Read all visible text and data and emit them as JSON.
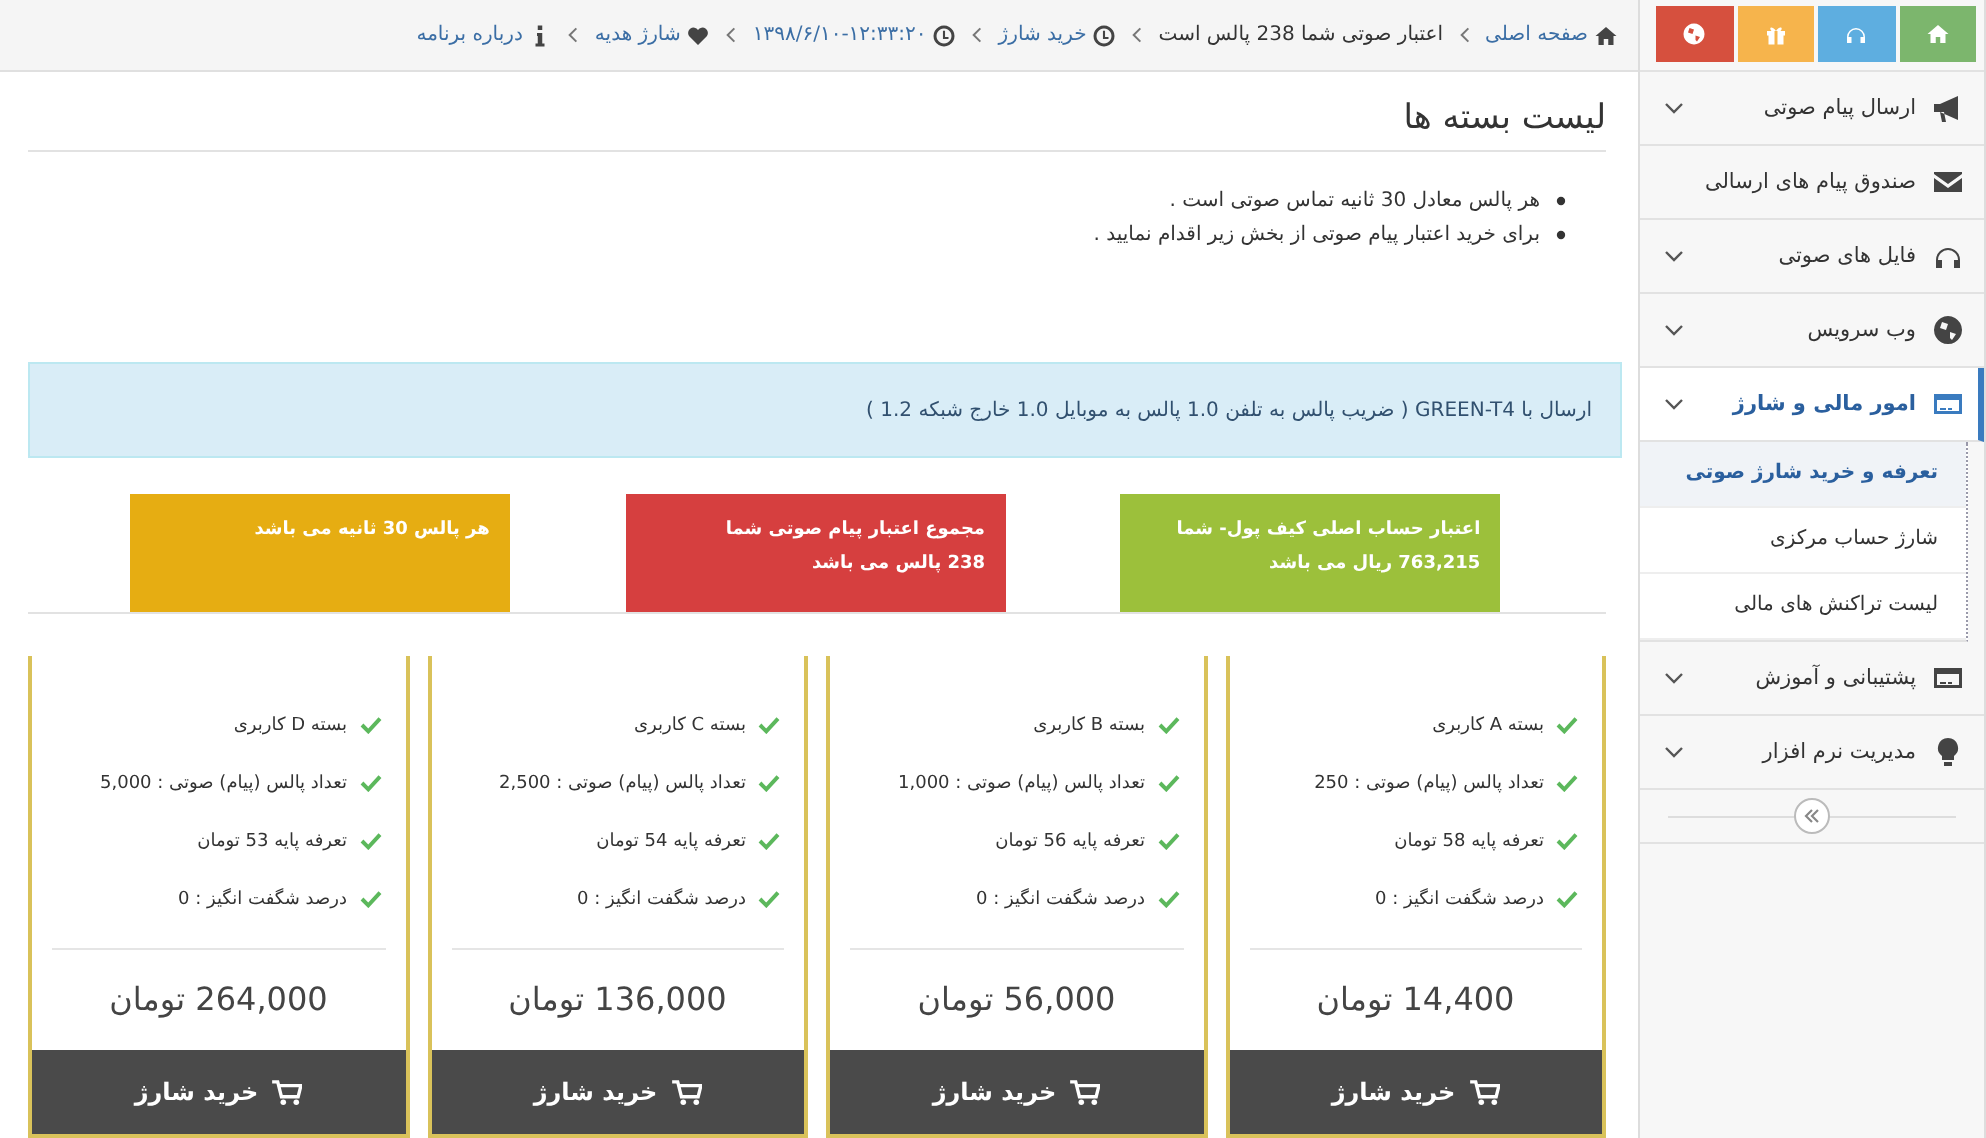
{
  "breadcrumb": [
    {
      "kind": "home",
      "text": "صفحه اصلی",
      "link": true
    },
    {
      "kind": "plain",
      "text": "اعتبار صوتی شما 238 پالس است",
      "link": false
    },
    {
      "kind": "clock",
      "text": "خرید شارژ",
      "link": true
    },
    {
      "kind": "clock",
      "text": "۱۳۹۸/۶/۱۰-۱۲:۳۳:۲۰",
      "link": true
    },
    {
      "kind": "heart",
      "text": "شارژ هدیه",
      "link": true
    },
    {
      "kind": "info",
      "text": "درباره برنامه",
      "link": true
    }
  ],
  "sidebar": {
    "shortcuts": [
      {
        "kind": "home",
        "color": "#7cb66d"
      },
      {
        "kind": "headphones",
        "color": "#5eaee0"
      },
      {
        "kind": "gift",
        "color": "#f6b44c"
      },
      {
        "kind": "globe",
        "color": "#d6503e"
      }
    ],
    "items": [
      {
        "kind": "megaphone",
        "label": "ارسال پیام صوتی",
        "expandable": true,
        "expanded": false
      },
      {
        "kind": "envelope",
        "label": "صندوق پیام های ارسالی",
        "expandable": false,
        "expanded": false
      },
      {
        "kind": "headphones",
        "label": "فایل های صوتی",
        "expandable": true,
        "expanded": false
      },
      {
        "kind": "globe",
        "label": "وب سرویس",
        "expandable": true,
        "expanded": false
      },
      {
        "kind": "card",
        "label": "امور مالی و شارژ",
        "expandable": true,
        "expanded": true,
        "children": [
          {
            "label": "تعرفه و خرید شارژ صوتی",
            "selected": true
          },
          {
            "label": "شارژ حساب مرکزی",
            "selected": false
          },
          {
            "label": "لیست تراکنش های مالی",
            "selected": false
          }
        ]
      },
      {
        "kind": "card",
        "label": "پشتیبانی و آموزش",
        "expandable": true,
        "expanded": false
      },
      {
        "kind": "bulb",
        "label": "مدیریت نرم افزار",
        "expandable": true,
        "expanded": false
      }
    ]
  },
  "page_title": "لیست بسته ها",
  "notes": [
    "هر پالس معادل 30 ثانیه تماس صوتی است .",
    "برای خرید اعتبار پیام صوتی از بخش زیر اقدام نمایید ."
  ],
  "alert": "ارسال با GREEN-T4 ( ضریب پالس به تلفن 1.0 پالس به موبایل 1.0 خارج شبکه 1.2 )",
  "stats": [
    {
      "color": "#9cc03b",
      "lines": [
        "اعتبار حساب اصلی کیف پول- شما",
        "763,215 ریال می باشد"
      ]
    },
    {
      "color": "#d63f3f",
      "lines": [
        "مجموع اعتبار پیام صوتی شما",
        "238 پالس می باشد"
      ]
    },
    {
      "color": "#e6ad12",
      "lines": [
        "هر پالس 30 ثانیه می باشد"
      ]
    }
  ],
  "packages": [
    {
      "features": [
        "بسته A کاربری",
        "تعداد پالس (پیام) صوتی : 250",
        "تعرفه پایه 58 تومان",
        "درصد شگفت انگیز : 0"
      ],
      "price": "14,400 تومان",
      "button": "خرید شارژ"
    },
    {
      "features": [
        "بسته B کاربری",
        "تعداد پالس (پیام) صوتی : 1,000",
        "تعرفه پایه 56 تومان",
        "درصد شگفت انگیز : 0"
      ],
      "price": "56,000 تومان",
      "button": "خرید شارژ"
    },
    {
      "features": [
        "بسته C کاربری",
        "تعداد پالس (پیام) صوتی : 2,500",
        "تعرفه پایه 54 تومان",
        "درصد شگفت انگیز : 0"
      ],
      "price": "136,000 تومان",
      "button": "خرید شارژ"
    },
    {
      "features": [
        "بسته D کاربری",
        "تعداد پالس (پیام) صوتی : 5,000",
        "تعرفه پایه 53 تومان",
        "درصد شگفت انگیز : 0"
      ],
      "price": "264,000 تومان",
      "button": "خرید شارژ"
    }
  ]
}
